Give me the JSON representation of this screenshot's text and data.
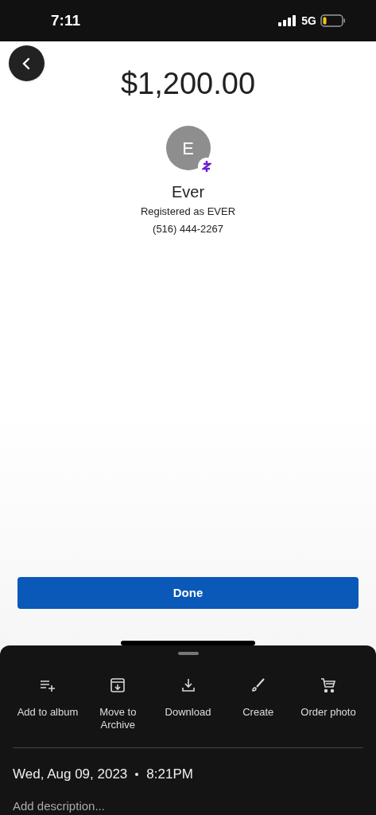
{
  "status_bar": {
    "time": "7:11",
    "network": "5G"
  },
  "payment": {
    "amount": "$1,200.00",
    "recipient": {
      "initial": "E",
      "name": "Ever",
      "registered": "Registered as EVER",
      "phone": "(516) 444-2267"
    }
  },
  "done_button": "Done",
  "sheet": {
    "actions": [
      {
        "kind": "album",
        "label": "Add to album"
      },
      {
        "kind": "archive",
        "label": "Move to Archive"
      },
      {
        "kind": "download",
        "label": "Download"
      },
      {
        "kind": "create",
        "label": "Create"
      },
      {
        "kind": "order",
        "label": "Order photo"
      }
    ],
    "date": "Wed, Aug 09, 2023",
    "time": "8:21PM",
    "description": {
      "placeholder": "Add description..."
    }
  }
}
